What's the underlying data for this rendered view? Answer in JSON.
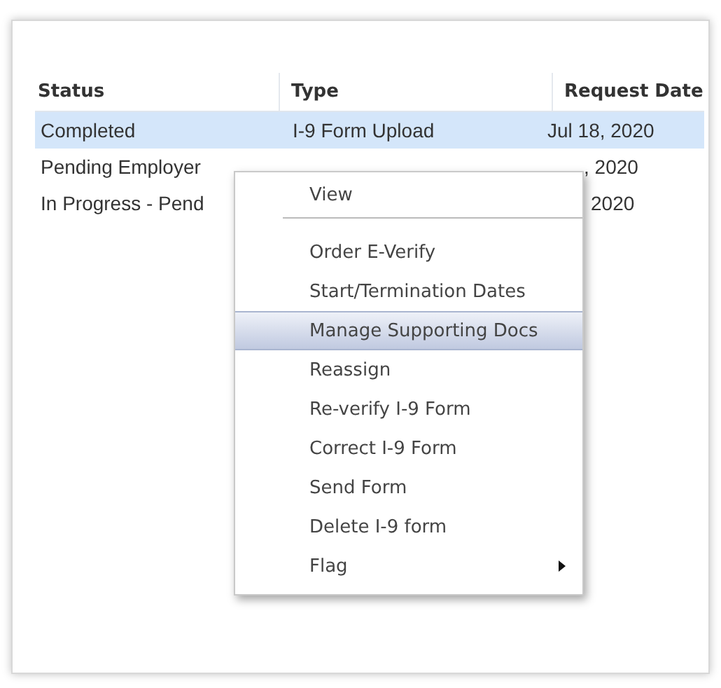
{
  "table": {
    "columns": [
      "Status",
      "Type",
      "Request Date"
    ],
    "rows": [
      {
        "selected": true,
        "cells": [
          "Completed",
          "I-9 Form Upload",
          "Jul 18, 2020"
        ]
      },
      {
        "selected": false,
        "cells": [
          "Pending Employer",
          "",
          ", 2020"
        ]
      },
      {
        "selected": false,
        "cells": [
          "In Progress - Pend",
          "",
          "2020"
        ]
      }
    ]
  },
  "context_menu": {
    "items": [
      {
        "kind": "item",
        "label": "View",
        "selected": false,
        "submenu": false
      },
      {
        "kind": "separator"
      },
      {
        "kind": "item",
        "label": "Order E-Verify",
        "selected": false,
        "submenu": false
      },
      {
        "kind": "item",
        "label": "Start/Termination Dates",
        "selected": false,
        "submenu": false
      },
      {
        "kind": "item",
        "label": "Manage Supporting Docs",
        "selected": true,
        "submenu": false
      },
      {
        "kind": "item",
        "label": "Reassign",
        "selected": false,
        "submenu": false
      },
      {
        "kind": "item",
        "label": "Re-verify I-9 Form",
        "selected": false,
        "submenu": false
      },
      {
        "kind": "item",
        "label": "Correct I-9 Form",
        "selected": false,
        "submenu": false
      },
      {
        "kind": "item",
        "label": "Send Form",
        "selected": false,
        "submenu": false
      },
      {
        "kind": "item",
        "label": "Delete I-9 form",
        "selected": false,
        "submenu": false
      },
      {
        "kind": "item",
        "label": "Flag",
        "selected": false,
        "submenu": true
      }
    ]
  }
}
